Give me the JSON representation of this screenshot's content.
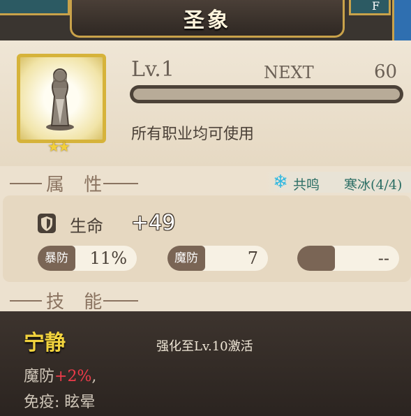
{
  "header": {
    "title": "圣象",
    "right_tab_text": "F"
  },
  "item": {
    "icon_name": "statue-icon",
    "stars": "★★",
    "level": "Lv.1",
    "next_label": "NEXT",
    "next_value": "60",
    "exp_fraction": 0,
    "usable_by": "所有职业均可使用"
  },
  "sections": {
    "attributes_title": "属 性",
    "skill_title": "技 能"
  },
  "resonance": {
    "icon_name": "snowflake-icon",
    "label": "共鸣",
    "value": "寒冰(4/4)"
  },
  "stats": {
    "hp_label": "生命",
    "hp_value": "+49",
    "crit_def_label": "暴防",
    "crit_def_value": "11%",
    "mdef_label": "魔防",
    "mdef_value": "7",
    "empty_value": "--"
  },
  "skill": {
    "name": "宁静",
    "activate_text": "强化至Lv.10激活",
    "line1_prefix": "魔防",
    "line1_bonus": "+2%",
    "line1_suffix": ",",
    "line2": "免疫: 眩晕"
  },
  "colors": {
    "gold": "#d6b33a",
    "resonance": "#2b6e64",
    "bonus_red": "#ee3b4a",
    "skill_name": "#f2d33e"
  }
}
